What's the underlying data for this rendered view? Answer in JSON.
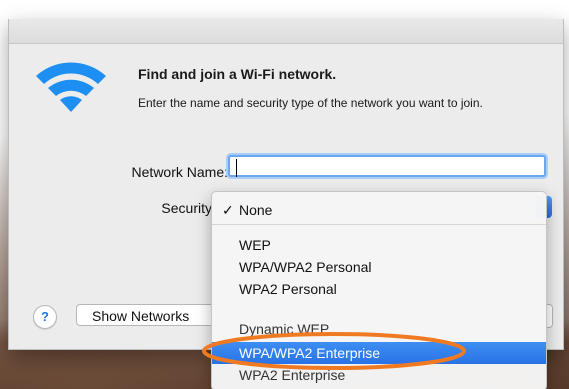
{
  "dialog": {
    "title": "Find and join a Wi-Fi network.",
    "description": "Enter the name and security type of the network you want to join.",
    "network_name_label": "Network Name:",
    "network_name_value": "",
    "security_label": "Security",
    "help_label": "?",
    "show_networks_label": "Show Networks"
  },
  "security_menu": {
    "items": [
      {
        "label": "None",
        "checked": true
      },
      {
        "label": "WEP",
        "checked": false
      },
      {
        "label": "WPA/WPA2 Personal",
        "checked": false
      },
      {
        "label": "WPA2 Personal",
        "checked": false
      },
      {
        "label": "Dynamic WEP",
        "checked": false
      },
      {
        "label": "WPA/WPA2 Enterprise",
        "checked": false,
        "highlighted": true
      },
      {
        "label": "WPA2 Enterprise",
        "checked": false
      }
    ],
    "checkmark": "✓"
  },
  "icons": {
    "wifi": "wifi-icon",
    "help": "help-icon"
  },
  "colors": {
    "wifi_blue": "#1e8ff2",
    "highlight": "#2a72e6",
    "annotation_orange": "#f07a22"
  }
}
